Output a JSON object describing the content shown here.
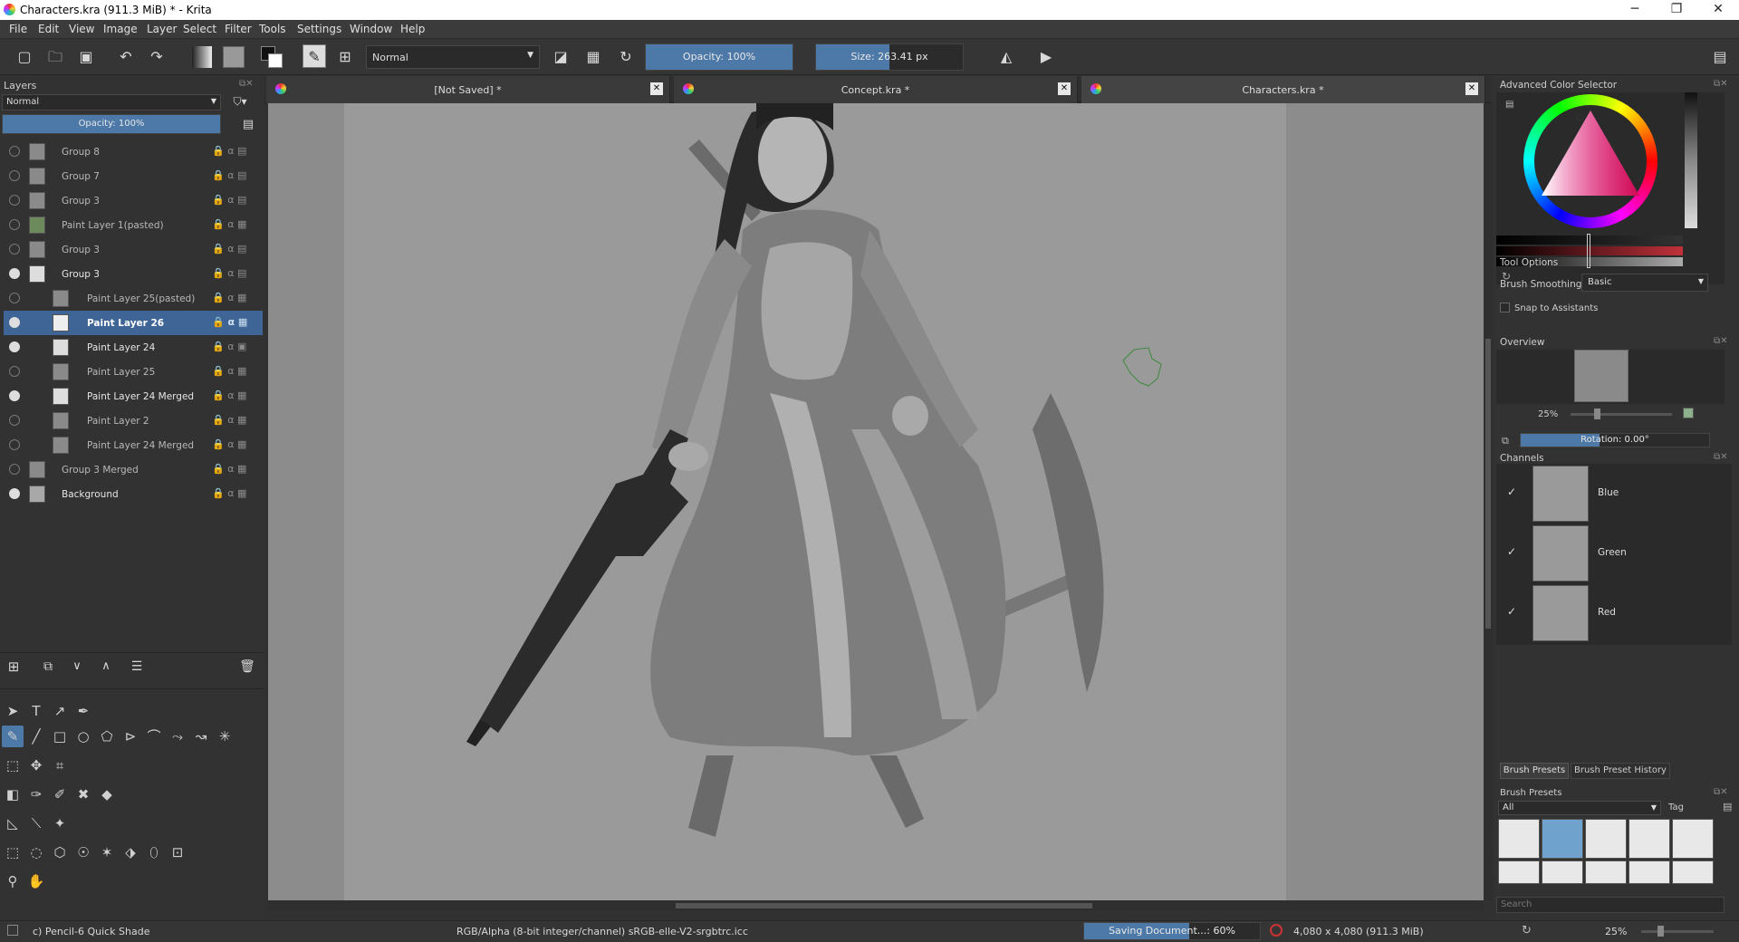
{
  "window": {
    "title": "Characters.kra (911.3 MiB)  * - Krita",
    "minimize": "─",
    "maximize": "❐",
    "close": "✕"
  },
  "menu": [
    "File",
    "Edit",
    "View",
    "Image",
    "Layer",
    "Select",
    "Filter",
    "Tools",
    "Settings",
    "Window",
    "Help"
  ],
  "toolbar": {
    "blend_mode": "Normal",
    "opacity": "Opacity: 100%",
    "opacity_value": 1.0,
    "size": "Size: 263.41 px",
    "size_fill": 0.5
  },
  "layers": {
    "title": "Layers",
    "blend_mode": "Normal",
    "opacity": "Opacity:  100%",
    "items": [
      {
        "name": "Group 8",
        "visible": false,
        "indent": 0
      },
      {
        "name": "Group 7",
        "visible": false,
        "indent": 0
      },
      {
        "name": "Group 3",
        "visible": false,
        "indent": 0
      },
      {
        "name": "Paint Layer 1(pasted)",
        "visible": false,
        "indent": 0
      },
      {
        "name": "Group 3",
        "visible": false,
        "indent": 0
      },
      {
        "name": "Group 3",
        "visible": true,
        "indent": 0
      },
      {
        "name": "Paint Layer 25(pasted)",
        "visible": false,
        "indent": 1
      },
      {
        "name": "Paint Layer 26",
        "visible": true,
        "indent": 1,
        "selected": true
      },
      {
        "name": "Paint Layer 24",
        "visible": true,
        "indent": 1
      },
      {
        "name": "Paint Layer 25",
        "visible": false,
        "indent": 1
      },
      {
        "name": "Paint Layer 24 Merged",
        "visible": true,
        "indent": 1
      },
      {
        "name": "Paint Layer 2",
        "visible": false,
        "indent": 1
      },
      {
        "name": "Paint Layer 24 Merged",
        "visible": false,
        "indent": 1
      },
      {
        "name": "Group 3 Merged",
        "visible": false,
        "indent": 0
      },
      {
        "name": "Background",
        "visible": true,
        "indent": 0
      }
    ]
  },
  "tabs": [
    {
      "label": "[Not Saved]  *",
      "close": "✕"
    },
    {
      "label": "Concept.kra *",
      "close": "✕"
    },
    {
      "label": "Characters.kra *",
      "close": "✕"
    }
  ],
  "right": {
    "color_selector": "Advanced Color Selector",
    "tool_options": "Tool Options",
    "brush_smoothing_label": "Brush Smoothing:",
    "brush_smoothing_value": "Basic",
    "snap_label": "Snap to Assistants",
    "overview": "Overview",
    "zoom": "25%",
    "rotation": "Rotation: 0.00°",
    "channels": "Channels",
    "channel_items": [
      {
        "name": "Blue",
        "check": "✓"
      },
      {
        "name": "Green",
        "check": "✓"
      },
      {
        "name": "Red",
        "check": "✓"
      }
    ],
    "preset_tabs": [
      "Brush Presets",
      "Brush Preset History"
    ],
    "presets_title": "Brush Presets",
    "presets_filter": "All",
    "presets_tag": "Tag",
    "search": "Search"
  },
  "status": {
    "brush": "c) Pencil-6 Quick Shade",
    "color": "RGB/Alpha (8-bit integer/channel)  sRGB-elle-V2-srgbtrc.icc",
    "saving": "Saving Document...: 60%",
    "saving_progress": 0.6,
    "dimensions": "4,080 x 4,080 (911.3 MiB)",
    "zoom": "25%"
  }
}
